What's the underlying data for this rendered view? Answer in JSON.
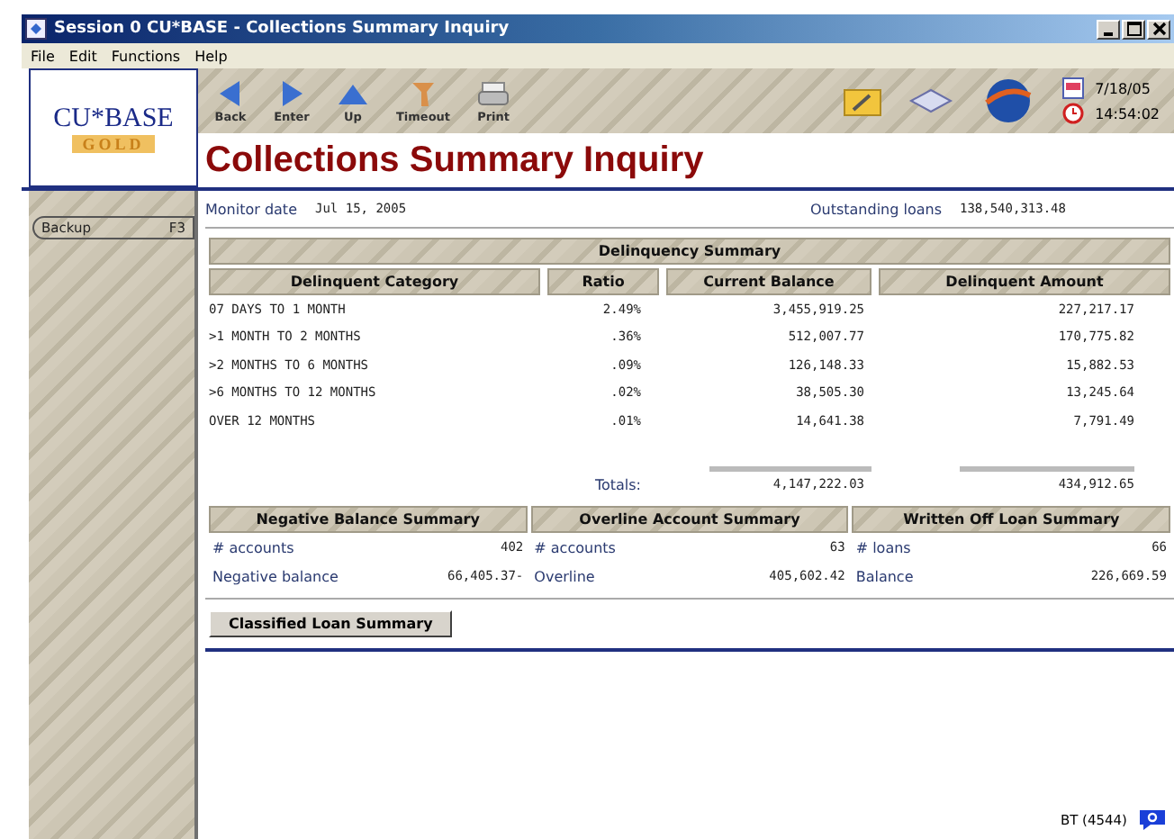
{
  "window": {
    "title": "Session 0 CU*BASE - Collections Summary Inquiry"
  },
  "menu": [
    "File",
    "Edit",
    "Functions",
    "Help"
  ],
  "toolbar": [
    {
      "label": "Back",
      "kind": "back"
    },
    {
      "label": "Enter",
      "kind": "enter"
    },
    {
      "label": "Up",
      "kind": "up"
    },
    {
      "label": "Timeout",
      "kind": "timeout"
    },
    {
      "label": "Print",
      "kind": "print"
    }
  ],
  "clock": {
    "date": "7/18/05",
    "time": "14:54:02"
  },
  "logo": {
    "text": "CU*BASE",
    "sub": "GOLD"
  },
  "page_title": "Collections Summary Inquiry",
  "sidebar": {
    "items": [
      {
        "label": "Backup",
        "key": "F3"
      }
    ]
  },
  "monitor": {
    "label": "Monitor date",
    "value": "Jul 15, 2005"
  },
  "outstanding": {
    "label": "Outstanding loans",
    "value": "138,540,313.48"
  },
  "delinquency": {
    "title": "Delinquency Summary",
    "columns": [
      "Delinquent Category",
      "Ratio",
      "Current Balance",
      "Delinquent Amount"
    ],
    "rows": [
      [
        "07 DAYS TO 1 MONTH",
        "2.49%",
        "3,455,919.25",
        "227,217.17"
      ],
      [
        ">1 MONTH TO 2 MONTHS",
        ".36%",
        "512,007.77",
        "170,775.82"
      ],
      [
        ">2 MONTHS TO 6 MONTHS",
        ".09%",
        "126,148.33",
        "15,882.53"
      ],
      [
        ">6 MONTHS TO 12 MONTHS",
        ".02%",
        "38,505.30",
        "13,245.64"
      ],
      [
        "OVER 12 MONTHS",
        ".01%",
        "14,641.38",
        "7,791.49"
      ]
    ],
    "totals": {
      "label": "Totals:",
      "current_balance": "4,147,222.03",
      "delinquent_amount": "434,912.65"
    }
  },
  "summaries": [
    {
      "title": "Negative Balance Summary",
      "rows": [
        {
          "label": "# accounts",
          "value": "402"
        },
        {
          "label": "Negative balance",
          "value": "66,405.37-"
        }
      ]
    },
    {
      "title": "Overline Account Summary",
      "rows": [
        {
          "label": "# accounts",
          "value": "63"
        },
        {
          "label": "Overline",
          "value": "405,602.42"
        }
      ]
    },
    {
      "title": "Written Off Loan Summary",
      "rows": [
        {
          "label": "# loans",
          "value": "66"
        },
        {
          "label": "Balance",
          "value": "226,669.59"
        }
      ]
    }
  ],
  "button": "Classified Loan Summary",
  "status": "BT (4544)"
}
